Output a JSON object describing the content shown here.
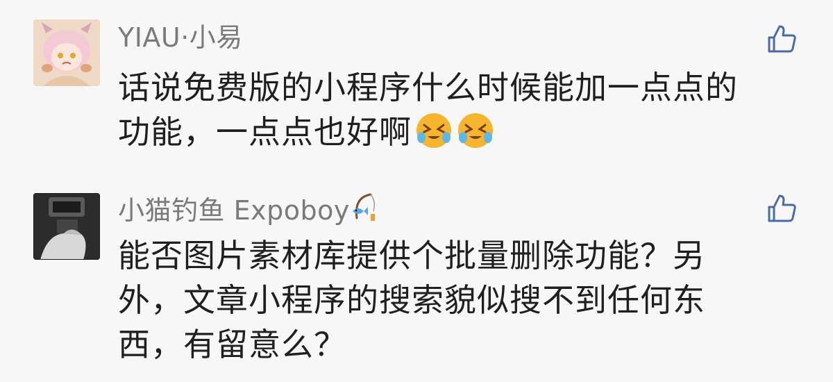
{
  "comments": [
    {
      "username": "YIAU·小易",
      "text_lines": [
        "话说免费版的小程序什么时候能加一点点的",
        "功能，一点点也好啊"
      ],
      "emojis": [
        "crying-laugh-emoji",
        "crying-laugh-emoji"
      ],
      "avatar": "anime-character-avatar",
      "like_icon": "thumbs-up-icon"
    },
    {
      "username": "小猫钓鱼 Expoboy",
      "text_lines": [
        "能否图片素材库提供个批量删除功能？另",
        "外，文章小程序的搜索貌似搜不到任何东",
        "西，有留意么？"
      ],
      "name_icons": [
        "unknown-glyph-icon",
        "fishing-icon"
      ],
      "avatar": "photo-avatar",
      "like_icon": "thumbs-up-icon"
    }
  ],
  "colors": {
    "background": "#f7f7f7",
    "username": "#7a7a7a",
    "text": "#1f1f1f",
    "like_icon": "#4a6aa8"
  }
}
